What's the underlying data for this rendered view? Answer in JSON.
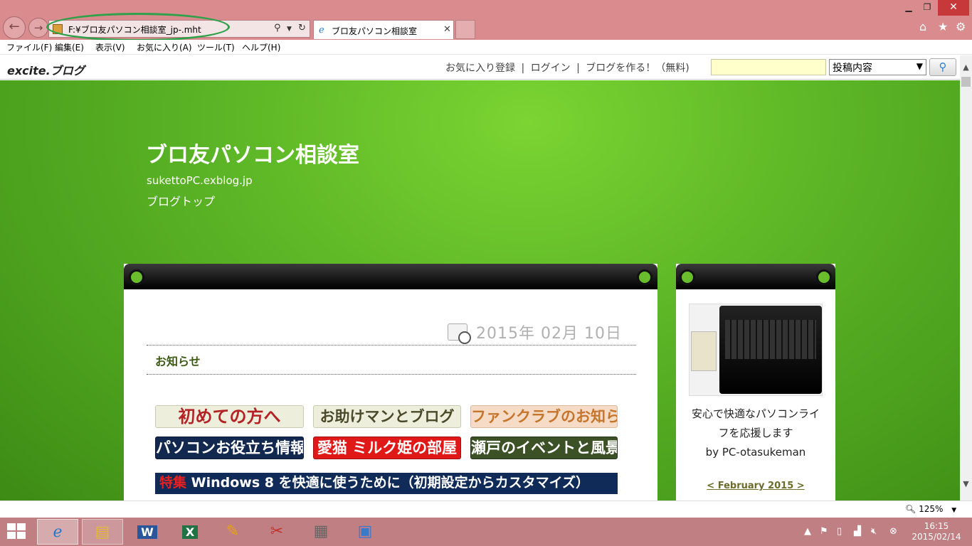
{
  "browser": {
    "address": "F:¥ブロ友パソコン相談室_jp-.mht",
    "tab_title": "ブロ友パソコン相談室",
    "menu": [
      "ファイル(F)",
      "編集(E)",
      "表示(V)",
      "お気に入り(A)",
      "ツール(T)",
      "ヘルプ(H)"
    ],
    "zoom": "125%"
  },
  "excite": {
    "logo": "excite.ブログ",
    "links": [
      "お気に入り登録",
      "ログイン",
      "ブログを作る！（無料)"
    ],
    "separator": "|",
    "search_select": "投稿内容"
  },
  "blog": {
    "title": "ブロ友パソコン相談室",
    "url": "sukettoPC.exblog.jp",
    "top_link": "ブログトップ"
  },
  "post": {
    "date": "2015年  02月  10日",
    "title": "お知らせ",
    "banners": {
      "first_time": "初めての方へ",
      "helper": "お助けマンとブログ",
      "fanclub": "ファンクラブのお知らせ",
      "pc_tips": "パソコンお役立ち情報 目次",
      "cat": "愛猫 ミルク姫の部屋",
      "seto": "瀬戸のイベントと風景",
      "win8_prefix": "特集",
      "win8_text": " Windows 8 を快適に使うために（初期設定からカスタマイズ）"
    }
  },
  "sidebar": {
    "caption_line1": "安心で快適なパソコンライ",
    "caption_line2": "フを応援します",
    "caption_line3": "by PC-otasukeman",
    "calendar_month": "February 2015",
    "calendar_prev": "<",
    "calendar_next": ">"
  },
  "clock": {
    "time": "16:15",
    "date": "2015/02/14"
  },
  "colors": {
    "chrome": "#d98b8e",
    "taskbar": "#c07f82",
    "page_green": "#5cb626",
    "highlight_ellipse": "#2ea14a"
  }
}
